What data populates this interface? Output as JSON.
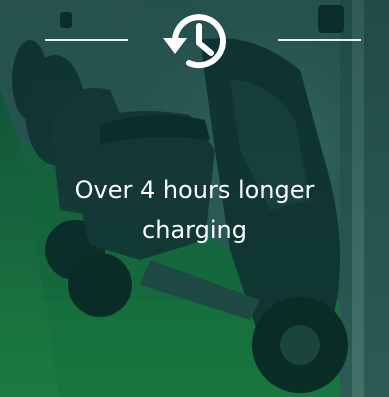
{
  "feature": {
    "icon": "history-clock-icon",
    "caption_line1": "Over 4 hours longer",
    "caption_line2": "charging"
  },
  "colors": {
    "overlay": "#0a4a3c",
    "text": "#ffffff",
    "floor": "#1f8a3f"
  }
}
